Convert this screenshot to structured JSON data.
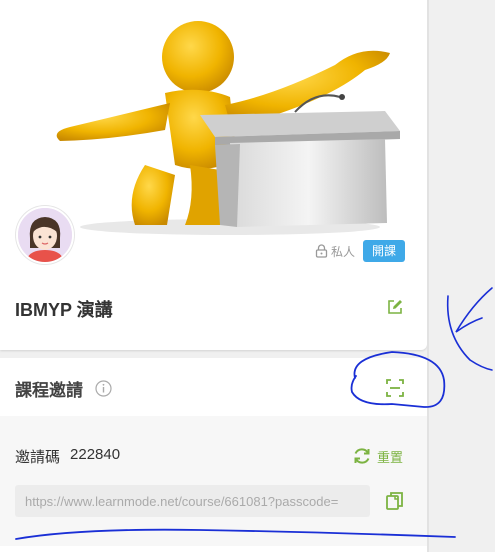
{
  "course": {
    "privacy_label": "私人",
    "open_badge": "開課",
    "title": "IBMYP 演講"
  },
  "invite": {
    "title": "課程邀請",
    "code_label": "邀請碼",
    "code_value": "222840",
    "reset_label": "重置",
    "url": "https://www.learnmode.net/course/661081?passcode="
  },
  "icons": {
    "privacy": "lock-icon",
    "edit": "edit-icon",
    "info": "info-icon",
    "scan": "qr-scan-icon",
    "reset": "refresh-icon",
    "copy": "copy-icon"
  },
  "colors": {
    "accent_green": "#7cb342",
    "badge_blue": "#3fa9e8",
    "annotation_ink": "#1a2fd6"
  }
}
